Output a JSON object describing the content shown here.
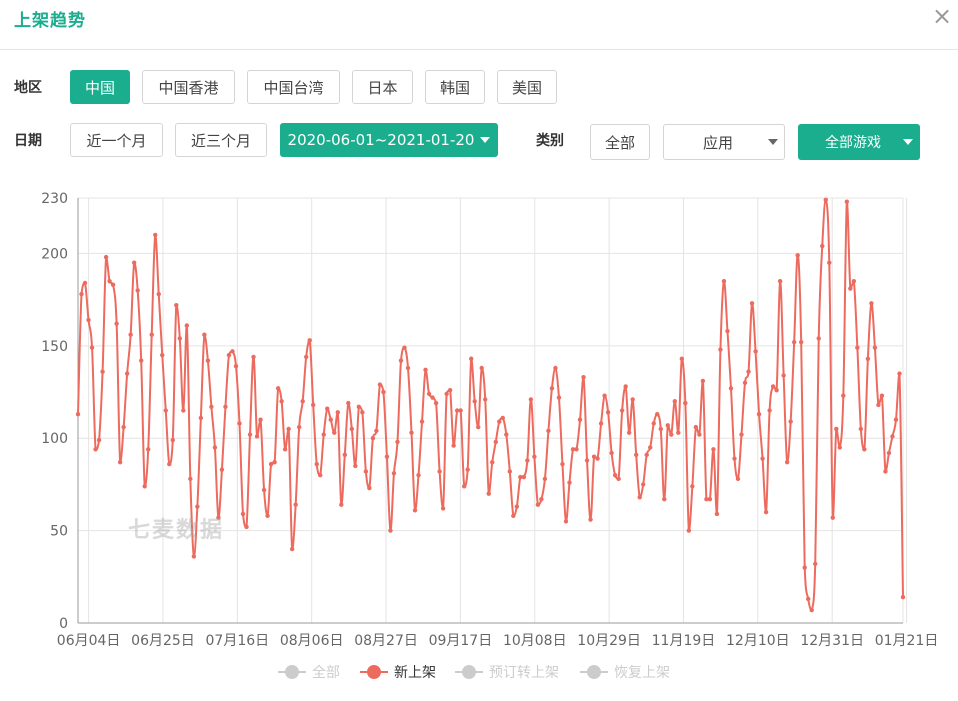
{
  "header": {
    "title": "上架趋势",
    "close_icon": "close-icon"
  },
  "filters": {
    "region_label": "地区",
    "regions": [
      "中国",
      "中国香港",
      "中国台湾",
      "日本",
      "韩国",
      "美国"
    ],
    "region_selected": "中国",
    "date_label": "日期",
    "date_quick": [
      "近一个月",
      "近三个月"
    ],
    "date_range": "2020-06-01~2021-01-20",
    "category_label": "类别",
    "category_all": "全部",
    "category_select": "应用",
    "game_select": "全部游戏"
  },
  "colors": {
    "accent": "#1aad8e",
    "series": "#ec6b5e",
    "inactive": "#cccccc"
  },
  "watermark": "七麦数据",
  "chart_data": {
    "type": "line",
    "title": "",
    "xlabel": "",
    "ylabel": "",
    "ylim": [
      0,
      230
    ],
    "yticks": [
      0,
      50,
      100,
      150,
      200,
      230
    ],
    "x_start": "2020-06-01",
    "x_end": "2021-01-20",
    "x_ticks": [
      "06月04日",
      "06月25日",
      "07月16日",
      "08月06日",
      "08月27日",
      "09月17日",
      "10月08日",
      "10月29日",
      "11月19日",
      "12月10日",
      "12月31日",
      "01月21日"
    ],
    "grid": true,
    "legend_position": "bottom",
    "legend": [
      {
        "name": "全部",
        "active": false
      },
      {
        "name": "新上架",
        "active": true
      },
      {
        "name": "预订转上架",
        "active": false
      },
      {
        "name": "恢复上架",
        "active": false
      }
    ],
    "series": [
      {
        "name": "新上架",
        "values": [
          113,
          178,
          184,
          164,
          149,
          94,
          99,
          136,
          198,
          185,
          183,
          162,
          87,
          106,
          135,
          156,
          195,
          180,
          142,
          74,
          94,
          156,
          210,
          178,
          145,
          115,
          86,
          99,
          172,
          154,
          115,
          161,
          78,
          36,
          63,
          111,
          156,
          142,
          117,
          95,
          57,
          83,
          117,
          145,
          147,
          139,
          108,
          59,
          52,
          102,
          144,
          101,
          110,
          72,
          58,
          86,
          87,
          127,
          120,
          94,
          105,
          40,
          64,
          106,
          120,
          144,
          153,
          118,
          86,
          80,
          102,
          116,
          110,
          103,
          114,
          64,
          91,
          119,
          105,
          85,
          117,
          114,
          82,
          73,
          100,
          104,
          129,
          125,
          90,
          50,
          81,
          98,
          142,
          149,
          138,
          103,
          61,
          80,
          109,
          137,
          124,
          122,
          119,
          82,
          62,
          124,
          126,
          96,
          115,
          115,
          74,
          83,
          143,
          120,
          106,
          138,
          121,
          70,
          87,
          98,
          109,
          111,
          102,
          82,
          58,
          63,
          79,
          79,
          88,
          121,
          90,
          64,
          67,
          78,
          104,
          127,
          138,
          122,
          86,
          55,
          76,
          94,
          94,
          110,
          133,
          88,
          56,
          90,
          89,
          108,
          123,
          114,
          92,
          80,
          78,
          115,
          128,
          103,
          121,
          91,
          68,
          75,
          91,
          95,
          108,
          113,
          105,
          67,
          107,
          102,
          120,
          103,
          143,
          119,
          50,
          74,
          106,
          102,
          131,
          67,
          67,
          94,
          59,
          148,
          185,
          158,
          127,
          89,
          78,
          102,
          130,
          136,
          173,
          147,
          113,
          89,
          60,
          115,
          128,
          126,
          185,
          134,
          87,
          109,
          152,
          199,
          152,
          30,
          13,
          7,
          32,
          154,
          204,
          229,
          195,
          57,
          105,
          95,
          123,
          228,
          181,
          185,
          149,
          105,
          94,
          143,
          173,
          149,
          118,
          123,
          82,
          92,
          101,
          110,
          135,
          14
        ]
      }
    ]
  }
}
